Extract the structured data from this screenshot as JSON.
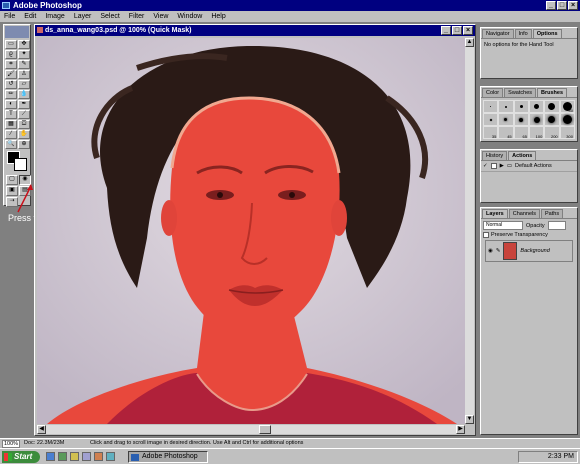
{
  "app": {
    "title": "Adobe Photoshop"
  },
  "menu": [
    "File",
    "Edit",
    "Image",
    "Layer",
    "Select",
    "Filter",
    "View",
    "Window",
    "Help"
  ],
  "document": {
    "title": "ds_anna_wang03.psd @ 100% (Quick Mask)"
  },
  "annotation": "Press this key to enter quick mask mode",
  "palettes": {
    "navigator": {
      "tabs": [
        "Navigator",
        "Info",
        "Options"
      ],
      "active": "Options",
      "text": "No options for the Hand Tool"
    },
    "color": {
      "tabs": [
        "Color",
        "Swatches",
        "Brushes"
      ],
      "active": "Brushes",
      "brush_sizes": [
        "35",
        "45",
        "65",
        "100",
        "200",
        "300"
      ],
      "size_label_40": "40"
    },
    "history": {
      "tabs": [
        "History",
        "Actions"
      ],
      "active": "Actions",
      "item": "Default Actions"
    },
    "layers": {
      "tabs": [
        "Layers",
        "Channels",
        "Paths"
      ],
      "active": "Layers",
      "mode": "Normal",
      "opacity_label": "Opacity",
      "preserve": "Preserve Transparency",
      "layer_name": "Background"
    }
  },
  "status": {
    "zoom": "100%",
    "doc": "Doc: 22.3M/23M",
    "hint": "Click and drag to scroll image in desired direction. Use Alt and Ctrl for additional options"
  },
  "taskbar": {
    "start": "Start",
    "task": "Adobe Photoshop",
    "time": "2:33 PM"
  },
  "colors": {
    "titlebar": "#000080",
    "mask": "#e8483c",
    "chrome": "#c0c0c0"
  },
  "icons": [
    "hand-icon",
    "zoom-icon",
    "marquee-icon",
    "move-icon",
    "lasso-icon",
    "crop-icon",
    "brush-icon",
    "eraser-icon",
    "quick-mask-icon"
  ]
}
